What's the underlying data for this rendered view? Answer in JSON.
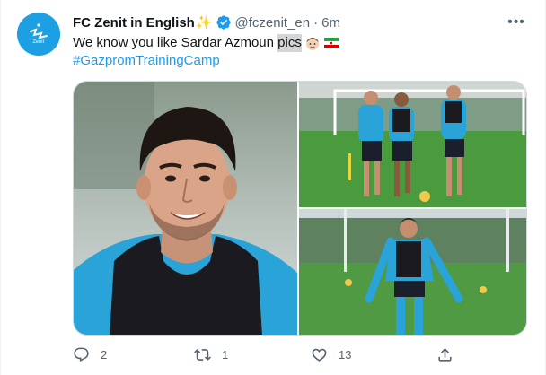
{
  "tweet": {
    "display_name": "FC Zenit in English",
    "name_emoji": "✨",
    "handle": "@fczenit_en",
    "separator": "·",
    "timestamp": "6m",
    "more_label": "•••",
    "text_before": "We know you like Sardar Azmoun ",
    "text_highlight": "pics",
    "text_emojis": [
      "man-face-emoji",
      "iran-flag-emoji"
    ],
    "hashtag": "#GazpromTrainingCamp",
    "avatar_icon": "zenit-logo-icon",
    "verified_icon": "verified-badge-icon",
    "accent_color": "#1d9bf0"
  },
  "media": {
    "images": [
      {
        "name": "photo-portrait",
        "depicts": "player-portrait"
      },
      {
        "name": "photo-training-group",
        "depicts": "players-training"
      },
      {
        "name": "photo-training-single",
        "depicts": "player-jogging"
      }
    ]
  },
  "actions": {
    "reply": {
      "icon": "reply-icon",
      "count": "2"
    },
    "retweet": {
      "icon": "retweet-icon",
      "count": "1"
    },
    "like": {
      "icon": "heart-icon",
      "count": "13"
    },
    "share": {
      "icon": "share-icon",
      "count": ""
    }
  }
}
